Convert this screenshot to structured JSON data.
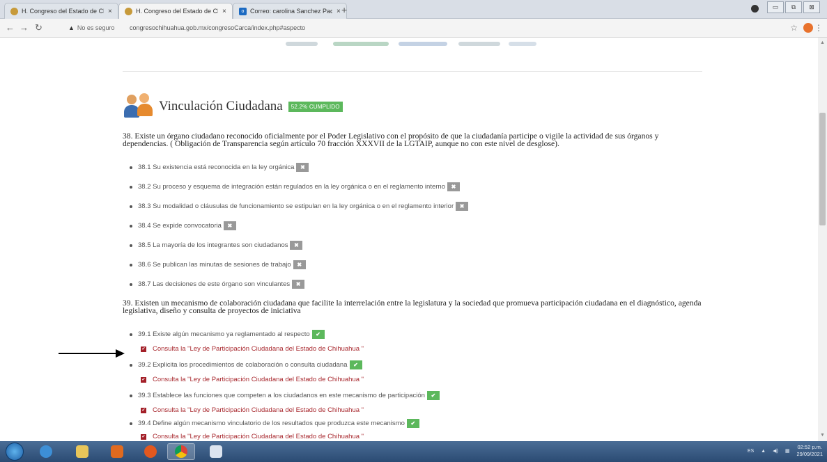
{
  "browser": {
    "tabs": [
      {
        "label": "H. Congreso del Estado de Chihu",
        "active": false
      },
      {
        "label": "H. Congreso del Estado de Chihu",
        "active": true
      },
      {
        "label": "Correo: carolina Sanchez Pacheco",
        "active": false
      }
    ],
    "close_glyph": "×",
    "new_tab_glyph": "+",
    "security_label": "No es seguro",
    "url": "congresochihuahua.gob.mx/congresoCarca/index.php#aspecto",
    "window_controls": [
      "▭",
      "⧉",
      "⊠"
    ]
  },
  "section": {
    "title": "Vinculación Ciudadana",
    "badge": "52.2% CUMPLIDO",
    "badge_color": "#5cb85c"
  },
  "questions": [
    {
      "text": "38. Existe un órgano ciudadano reconocido oficialmente por el Poder Legislativo con el propósito de que la ciudadanía participe o vigile la actividad de sus órganos y dependencias. ( Obligación de Transparencia según artículo 70 fracción XXXVII de la LGTAIP, aunque no con este nivel de desglose).",
      "items": [
        {
          "label": "38.1 Su existencia está reconocida en la ley orgánica",
          "status": "no"
        },
        {
          "label": "38.2 Su proceso y esquema de integración están regulados en la ley orgánica o en el reglamento interno",
          "status": "no"
        },
        {
          "label": "38.3 Su modalidad o cláusulas de funcionamiento se estipulan en la ley orgánica o en el reglamento interior",
          "status": "no"
        },
        {
          "label": "38.4 Se expide convocatoria",
          "status": "no"
        },
        {
          "label": "38.5 La mayoría de los integrantes son ciudadanos",
          "status": "no"
        },
        {
          "label": "38.6 Se publican las minutas de sesiones de trabajo",
          "status": "no"
        },
        {
          "label": "38.7 Las decisiones de este órgano son vinculantes",
          "status": "no"
        }
      ]
    },
    {
      "text": "39. Existen un mecanismo de colaboración ciudadana que facilite la interrelación entre la legislatura y la sociedad que promueva participación ciudadana en el diagnóstico, agenda legislativa, diseño y consulta de proyectos de iniciativa",
      "items": [
        {
          "label": "39.1 Existe algún mecanismo ya reglamentado al respecto",
          "status": "yes",
          "link": "Consulta la \"Ley de Participación Ciudadana del Estado de Chihuahua \""
        },
        {
          "label": "39.2 Explicita los procedimientos de colaboración o consulta ciudadana",
          "status": "yes",
          "link": "Consulta la \"Ley de Participación Ciudadana del Estado de Chihuahua \""
        },
        {
          "label": "39.3 Establece las funciones que competen a los ciudadanos en este mecanismo de participación",
          "status": "yes",
          "link": "Consulta la \"Ley de Participación Ciudadana del Estado de Chihuahua \""
        },
        {
          "label": "39.4 Define algún mecanismo vinculatorio de los resultados que produzca este mecanismo",
          "status": "yes",
          "link": "Consulta la \"Ley de Participación Ciudadana del Estado de Chihuahua \""
        }
      ]
    }
  ],
  "taskbar": {
    "language": "ES",
    "time": "02:52 p.m.",
    "date": "29/09/2021"
  },
  "colors": {
    "status_no": "#999999",
    "status_yes": "#5cb85c",
    "link": "#a8282e"
  }
}
